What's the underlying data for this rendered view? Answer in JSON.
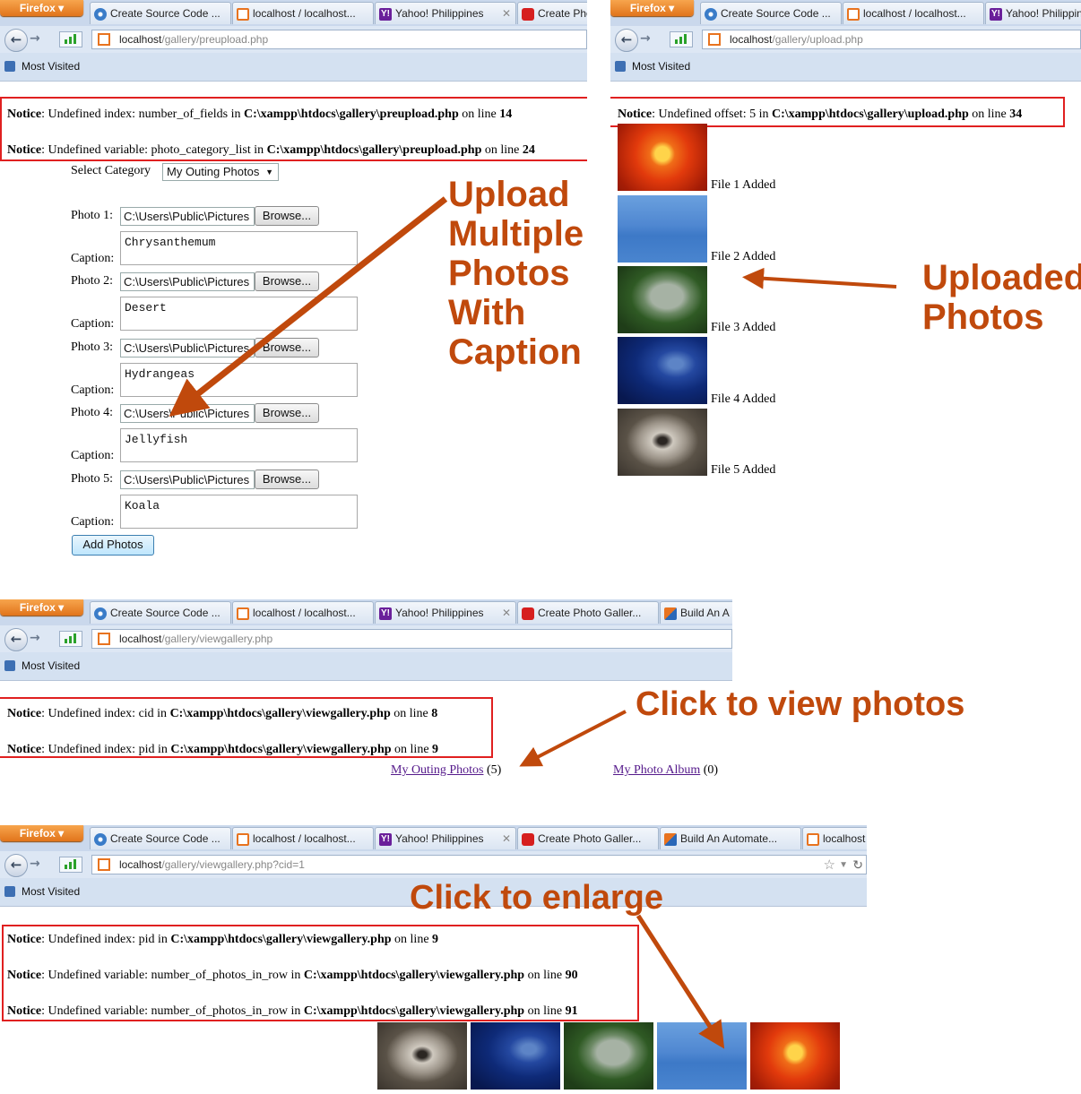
{
  "firefox_label": "Firefox",
  "tabs": {
    "t1": "Create Source Code ...",
    "t2": "localhost / localhost...",
    "t3": "Yahoo! Philippines",
    "t4": "Create Pho",
    "t3_short": "Yahoo! Philippin",
    "t4_full": "Create Photo Galler...",
    "t5_short": "Build An A",
    "t5": "Build An Automate...",
    "t6": "localhost"
  },
  "bookmarks_label": "Most Visited",
  "panel1": {
    "url_host": "localhost",
    "url_path": "/gallery/preupload.php",
    "notices": [
      {
        "word": "Notice",
        "text": ": Undefined index: number_of_fields in ",
        "file": "C:\\xampp\\htdocs\\gallery\\preupload.php",
        "online": " on line ",
        "line": "14"
      },
      {
        "word": "Notice",
        "text": ": Undefined variable: photo_category_list in ",
        "file": "C:\\xampp\\htdocs\\gallery\\preupload.php",
        "online": " on line ",
        "line": "24"
      }
    ],
    "select_category_label": "Select Category",
    "category_selected": "My Outing Photos",
    "photo_labels": [
      "Photo 1:",
      "Photo 2:",
      "Photo 3:",
      "Photo 4:",
      "Photo 5:"
    ],
    "caption_label": "Caption:",
    "file_value": "C:\\Users\\Public\\Pictures",
    "browse_label": "Browse...",
    "captions": [
      "Chrysanthemum",
      "Desert",
      "Hydrangeas",
      "Jellyfish",
      "Koala"
    ],
    "add_photos_label": "Add Photos"
  },
  "panel2": {
    "url_host": "localhost",
    "url_path": "/gallery/upload.php",
    "notice": {
      "word": "Notice",
      "text": ": Undefined offset: 5 in ",
      "file": "C:\\xampp\\htdocs\\gallery\\upload.php",
      "online": " on line ",
      "line": "34"
    },
    "file_added": [
      "File 1 Added",
      "File 2 Added",
      "File 3 Added",
      "File 4 Added",
      "File 5 Added"
    ]
  },
  "panel3": {
    "url_host": "localhost",
    "url_path": "/gallery/viewgallery.php",
    "notices": [
      {
        "word": "Notice",
        "text": ": Undefined index: cid in ",
        "file": "C:\\xampp\\htdocs\\gallery\\viewgallery.php",
        "online": " on line ",
        "line": "8"
      },
      {
        "word": "Notice",
        "text": ": Undefined index: pid in ",
        "file": "C:\\xampp\\htdocs\\gallery\\viewgallery.php",
        "online": " on line ",
        "line": "9"
      }
    ],
    "albums": [
      {
        "name": "My Outing Photos",
        "count": "(5)"
      },
      {
        "name": "My Photo Album",
        "count": "(0)"
      }
    ]
  },
  "panel4": {
    "url_host": "localhost",
    "url_path": "/gallery/viewgallery.php?cid=1",
    "notices": [
      {
        "word": "Notice",
        "text": ": Undefined index: pid in ",
        "file": "C:\\xampp\\htdocs\\gallery\\viewgallery.php",
        "online": " on line ",
        "line": "9"
      },
      {
        "word": "Notice",
        "text": ": Undefined variable: number_of_photos_in_row in ",
        "file": "C:\\xampp\\htdocs\\gallery\\viewgallery.php",
        "online": " on line ",
        "line": "90"
      },
      {
        "word": "Notice",
        "text": ": Undefined variable: number_of_photos_in_row in ",
        "file": "C:\\xampp\\htdocs\\gallery\\viewgallery.php",
        "online": " on line ",
        "line": "91"
      }
    ]
  },
  "annotations": {
    "upload_lines": [
      "Upload",
      "Multiple",
      "Photos",
      "With",
      "Caption"
    ],
    "uploaded_lines": [
      "Uploaded",
      "Photos"
    ],
    "click_view": "Click to view photos",
    "click_enlarge": "Click to enlarge"
  },
  "colors": {
    "annotation": "#c0490c",
    "notice_border": "#e02020",
    "tabbar": "#cad8ec"
  }
}
